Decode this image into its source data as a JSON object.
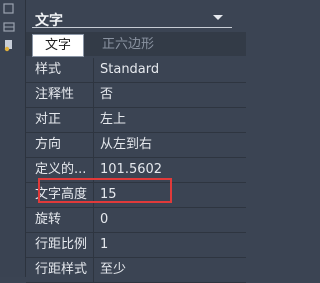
{
  "icons": {
    "strip": [
      "toolbar-icon-1",
      "toolbar-icon-2",
      "toolbar-icon-3"
    ],
    "chevron": "chevron-down-icon"
  },
  "header": {
    "title": "文字"
  },
  "tabs": [
    {
      "label": "文字",
      "active": true
    },
    {
      "label": "正六边形",
      "active": false
    }
  ],
  "properties": [
    {
      "label": "样式",
      "value": "Standard"
    },
    {
      "label": "注释性",
      "value": "否"
    },
    {
      "label": "对正",
      "value": "左上"
    },
    {
      "label": "方向",
      "value": "从左到右"
    },
    {
      "label": "定义的...",
      "value": "101.5602"
    },
    {
      "label": "文字高度",
      "value": "15"
    },
    {
      "label": "旋转",
      "value": "0"
    },
    {
      "label": "行距比例",
      "value": "1"
    },
    {
      "label": "行距样式",
      "value": "至少"
    }
  ],
  "colors": {
    "panel_bg": "#3b4453",
    "highlight": "#e03a3a",
    "active_tab_bg": "#ffffff"
  }
}
